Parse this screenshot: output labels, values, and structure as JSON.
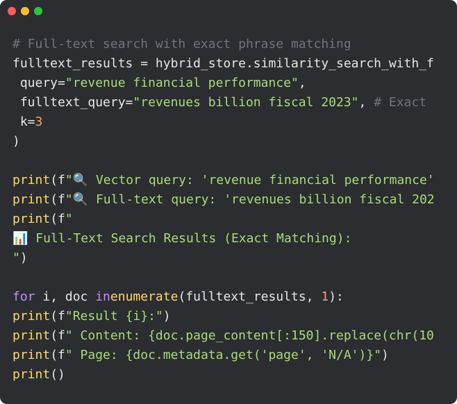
{
  "window": {
    "controls": [
      {
        "name": "close",
        "color": "#ff5f57"
      },
      {
        "name": "minimize",
        "color": "#febc2e"
      },
      {
        "name": "zoom",
        "color": "#28c840"
      }
    ]
  },
  "colors": {
    "background": "#2b2d31",
    "comment": "#6f747c",
    "string": "#a9dc76",
    "builtin": "#ffd866",
    "keyword": "#c48ef7",
    "number": "#ff9e64",
    "text": "#e6e6e6"
  },
  "code": {
    "lines": [
      [
        {
          "t": "# Full-text search with exact phrase matching",
          "k": "comment"
        }
      ],
      [
        {
          "t": "fulltext_results = hybrid_store.similarity_search_with_f",
          "k": "plain"
        }
      ],
      [
        {
          "t": " query=",
          "k": "plain"
        },
        {
          "t": "\"revenue financial performance\"",
          "k": "string"
        },
        {
          "t": ",",
          "k": "plain"
        }
      ],
      [
        {
          "t": " fulltext_query=",
          "k": "plain"
        },
        {
          "t": "\"revenues billion fiscal 2023\"",
          "k": "string"
        },
        {
          "t": ", ",
          "k": "plain"
        },
        {
          "t": "# Exact",
          "k": "comment"
        }
      ],
      [
        {
          "t": " k=",
          "k": "plain"
        },
        {
          "t": "3",
          "k": "number"
        }
      ],
      [
        {
          "t": ")",
          "k": "plain"
        }
      ],
      [],
      [
        {
          "t": "print",
          "k": "builtin"
        },
        {
          "t": "(f",
          "k": "plain"
        },
        {
          "t": "\"🔍 Vector query: 'revenue financial performance'",
          "k": "string"
        }
      ],
      [
        {
          "t": "print",
          "k": "builtin"
        },
        {
          "t": "(f",
          "k": "plain"
        },
        {
          "t": "\"🔍 Full-text query: 'revenues billion fiscal 202",
          "k": "string"
        }
      ],
      [
        {
          "t": "print",
          "k": "builtin"
        },
        {
          "t": "(f",
          "k": "plain"
        },
        {
          "t": "\"",
          "k": "string"
        }
      ],
      [
        {
          "t": "📊 Full-Text Search Results (Exact Matching):",
          "k": "string"
        }
      ],
      [
        {
          "t": "\"",
          "k": "string"
        },
        {
          "t": ")",
          "k": "plain"
        }
      ],
      [],
      [
        {
          "t": "for",
          "k": "keyword"
        },
        {
          "t": " i, doc ",
          "k": "plain"
        },
        {
          "t": "in",
          "k": "keyword"
        },
        {
          "t": "enumerate",
          "k": "builtin"
        },
        {
          "t": "(fulltext_results, ",
          "k": "plain"
        },
        {
          "t": "1",
          "k": "number"
        },
        {
          "t": "):",
          "k": "plain"
        }
      ],
      [
        {
          "t": "print",
          "k": "builtin"
        },
        {
          "t": "(f",
          "k": "plain"
        },
        {
          "t": "\"Result {i}:\"",
          "k": "string"
        },
        {
          "t": ")",
          "k": "plain"
        }
      ],
      [
        {
          "t": "print",
          "k": "builtin"
        },
        {
          "t": "(f",
          "k": "plain"
        },
        {
          "t": "\" Content: {doc.page_content[:150].replace(chr(10",
          "k": "string"
        }
      ],
      [
        {
          "t": "print",
          "k": "builtin"
        },
        {
          "t": "(f",
          "k": "plain"
        },
        {
          "t": "\" Page: {doc.metadata.get('page', 'N/A')}\"",
          "k": "string"
        },
        {
          "t": ")",
          "k": "plain"
        }
      ],
      [
        {
          "t": "print",
          "k": "builtin"
        },
        {
          "t": "()",
          "k": "plain"
        }
      ]
    ]
  }
}
